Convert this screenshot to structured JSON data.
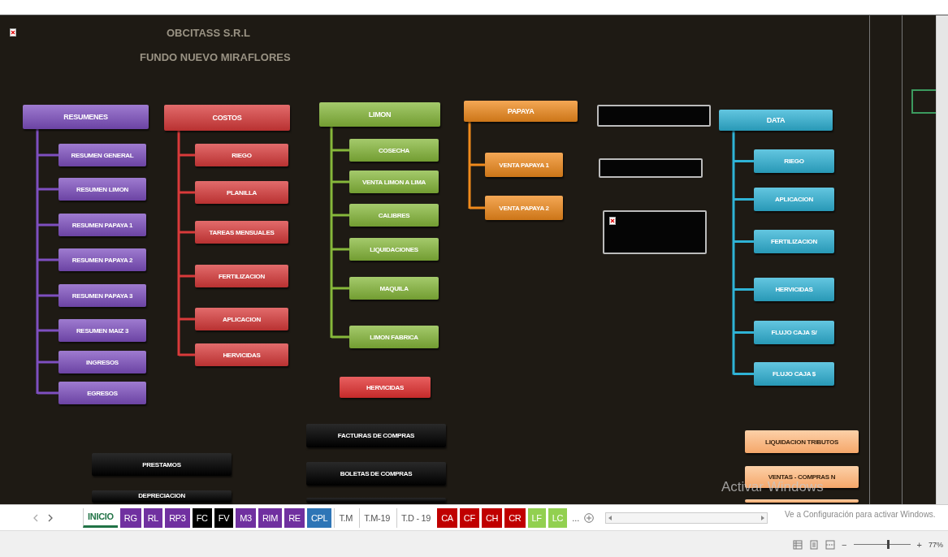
{
  "sheet": {
    "header": {
      "title": "OBCITASS S.R.L",
      "subtitle": "FUNDO NUEVO MIRAFLORES"
    },
    "trees": [
      {
        "color": "#7e4fc0",
        "header": "RESUMENES",
        "children": [
          "RESUMEN GENERAL",
          "RESUMEN LIMON",
          "RESUMEN PAPAYA 1",
          "RESUMEN PAPAYA 2",
          "RESUMEN PAPAYA 3",
          "RESUMEN MAIZ 3",
          "INGRESOS",
          "EGRESOS"
        ]
      },
      {
        "color": "#d93a3a",
        "header": "COSTOS",
        "children": [
          "RIEGO",
          "PLANILLA",
          "TAREAS MENSUALES",
          "FERTILIZACION",
          "APLICACION",
          "HERVICIDAS"
        ]
      },
      {
        "color": "#86b83a",
        "header": "LIMON",
        "children": [
          "COSECHA",
          "VENTA LIMON A LIMA",
          "CALIBRES",
          "LIQUIDACIONES",
          "MAQUILA",
          "LIMON FABRICA"
        ]
      },
      {
        "color": "#f08a1c",
        "header": "PAPAYA",
        "children": [
          "VENTA PAPAYA 1",
          "VENTA PAPAYA 2"
        ]
      },
      {
        "color": "#2fb3d6",
        "header": "DATA",
        "children": [
          "RIEGO",
          "APLICACION",
          "FERTILIZACION",
          "HERVICIDAS",
          "FLUJO CAJA S/",
          "FLUJO CAJA $"
        ]
      }
    ],
    "buttons": [
      {
        "kind": "red",
        "label": "HERVICIDAS"
      },
      {
        "kind": "black",
        "label": "FACTURAS DE COMPRAS"
      },
      {
        "kind": "black",
        "label": "BOLETAS  DE COMPRAS"
      },
      {
        "kind": "black"
      },
      {
        "kind": "black",
        "label": "PRESTAMOS"
      },
      {
        "kind": "black",
        "label": "DEPRECIACION"
      },
      {
        "kind": "peach",
        "label": "LIQUIDACION TRIBUTOS"
      },
      {
        "kind": "peach",
        "label": "VENTAS - COMPRAS N"
      },
      {
        "kind": "peach"
      }
    ]
  },
  "sheet_tabs": [
    {
      "label": "INICIO",
      "color": "#ffffff",
      "selected": true
    },
    {
      "label": "RG",
      "color": "#7030a0",
      "selected": false
    },
    {
      "label": "RL",
      "color": "#7030a0",
      "selected": false
    },
    {
      "label": "RP3",
      "color": "#7030a0",
      "selected": false
    },
    {
      "label": "FC",
      "color": "#000000",
      "selected": false
    },
    {
      "label": "FV",
      "color": "#000000",
      "selected": false
    },
    {
      "label": "M3",
      "color": "#7030a0",
      "selected": false
    },
    {
      "label": "RIM",
      "color": "#7030a0",
      "selected": false
    },
    {
      "label": "RE",
      "color": "#7030a0",
      "selected": false
    },
    {
      "label": "CPL",
      "color": "#2e75b6",
      "selected": false
    },
    {
      "label": "T.M",
      "color": "#ffffff",
      "selected": false
    },
    {
      "label": "T.M-19",
      "color": "#ffffff",
      "selected": false
    },
    {
      "label": "T.D - 19",
      "color": "#ffffff",
      "selected": false
    },
    {
      "label": "CA",
      "color": "#c00000",
      "selected": false
    },
    {
      "label": "CF",
      "color": "#c00000",
      "selected": false
    },
    {
      "label": "CH",
      "color": "#c00000",
      "selected": false
    },
    {
      "label": "CR",
      "color": "#c00000",
      "selected": false
    },
    {
      "label": "LF",
      "color": "#92d050",
      "selected": false
    },
    {
      "label": "LC",
      "color": "#92d050",
      "selected": false
    }
  ],
  "more_tabs": "...",
  "status_bar": {
    "zoom_out": "−",
    "zoom_in": "+",
    "zoom": "77%",
    "level": 0.6
  },
  "activation_notice": {
    "title": "Activar Windows",
    "text": "Ve a Configuración para activar Windows."
  }
}
